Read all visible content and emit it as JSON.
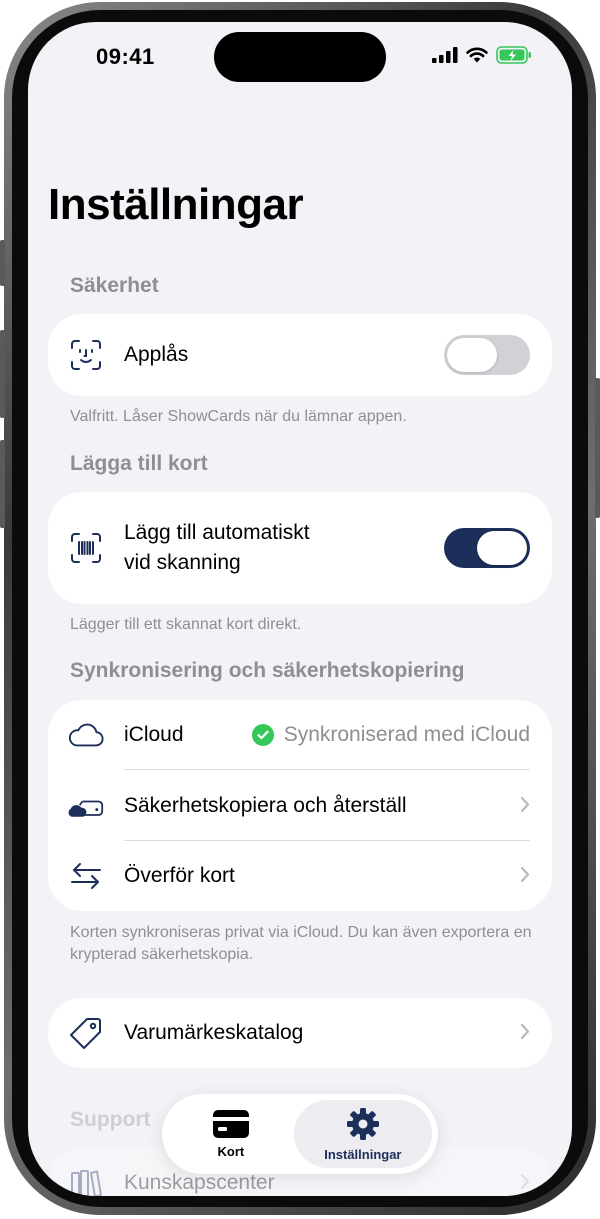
{
  "status_bar": {
    "time": "09:41"
  },
  "page": {
    "title": "Inställningar"
  },
  "sections": {
    "security": {
      "header": "Säkerhet",
      "app_lock": {
        "label": "Applås",
        "enabled": false
      },
      "footnote": "Valfritt. Låser ShowCards när du lämnar appen."
    },
    "add_cards": {
      "header": "Lägga till kort",
      "auto_add": {
        "label_line1": "Lägg till automatiskt",
        "label_line2": "vid skanning",
        "enabled": true
      },
      "footnote": "Lägger till ett skannat kort direkt."
    },
    "sync": {
      "header": "Synkronisering och säkerhetskopiering",
      "icloud": {
        "label": "iCloud",
        "status": "Synkroniserad med iCloud"
      },
      "backup": {
        "label": "Säkerhetskopiera och återställ"
      },
      "transfer": {
        "label": "Överför kort"
      },
      "footnote": "Korten synkroniseras privat via iCloud. Du kan även exportera en krypterad säkerhetskopia."
    },
    "brand_catalog": {
      "label": "Varumärkeskatalog"
    },
    "support": {
      "header": "Support",
      "knowledge": {
        "label": "Kunskapscenter"
      }
    }
  },
  "tabbar": {
    "cards": {
      "label": "Kort",
      "icon": "card-icon"
    },
    "settings": {
      "label": "Inställningar",
      "icon": "gear-icon",
      "active": true
    }
  },
  "colors": {
    "accent": "#1c2f5a",
    "success": "#34c759",
    "background": "#f2f2f7"
  }
}
